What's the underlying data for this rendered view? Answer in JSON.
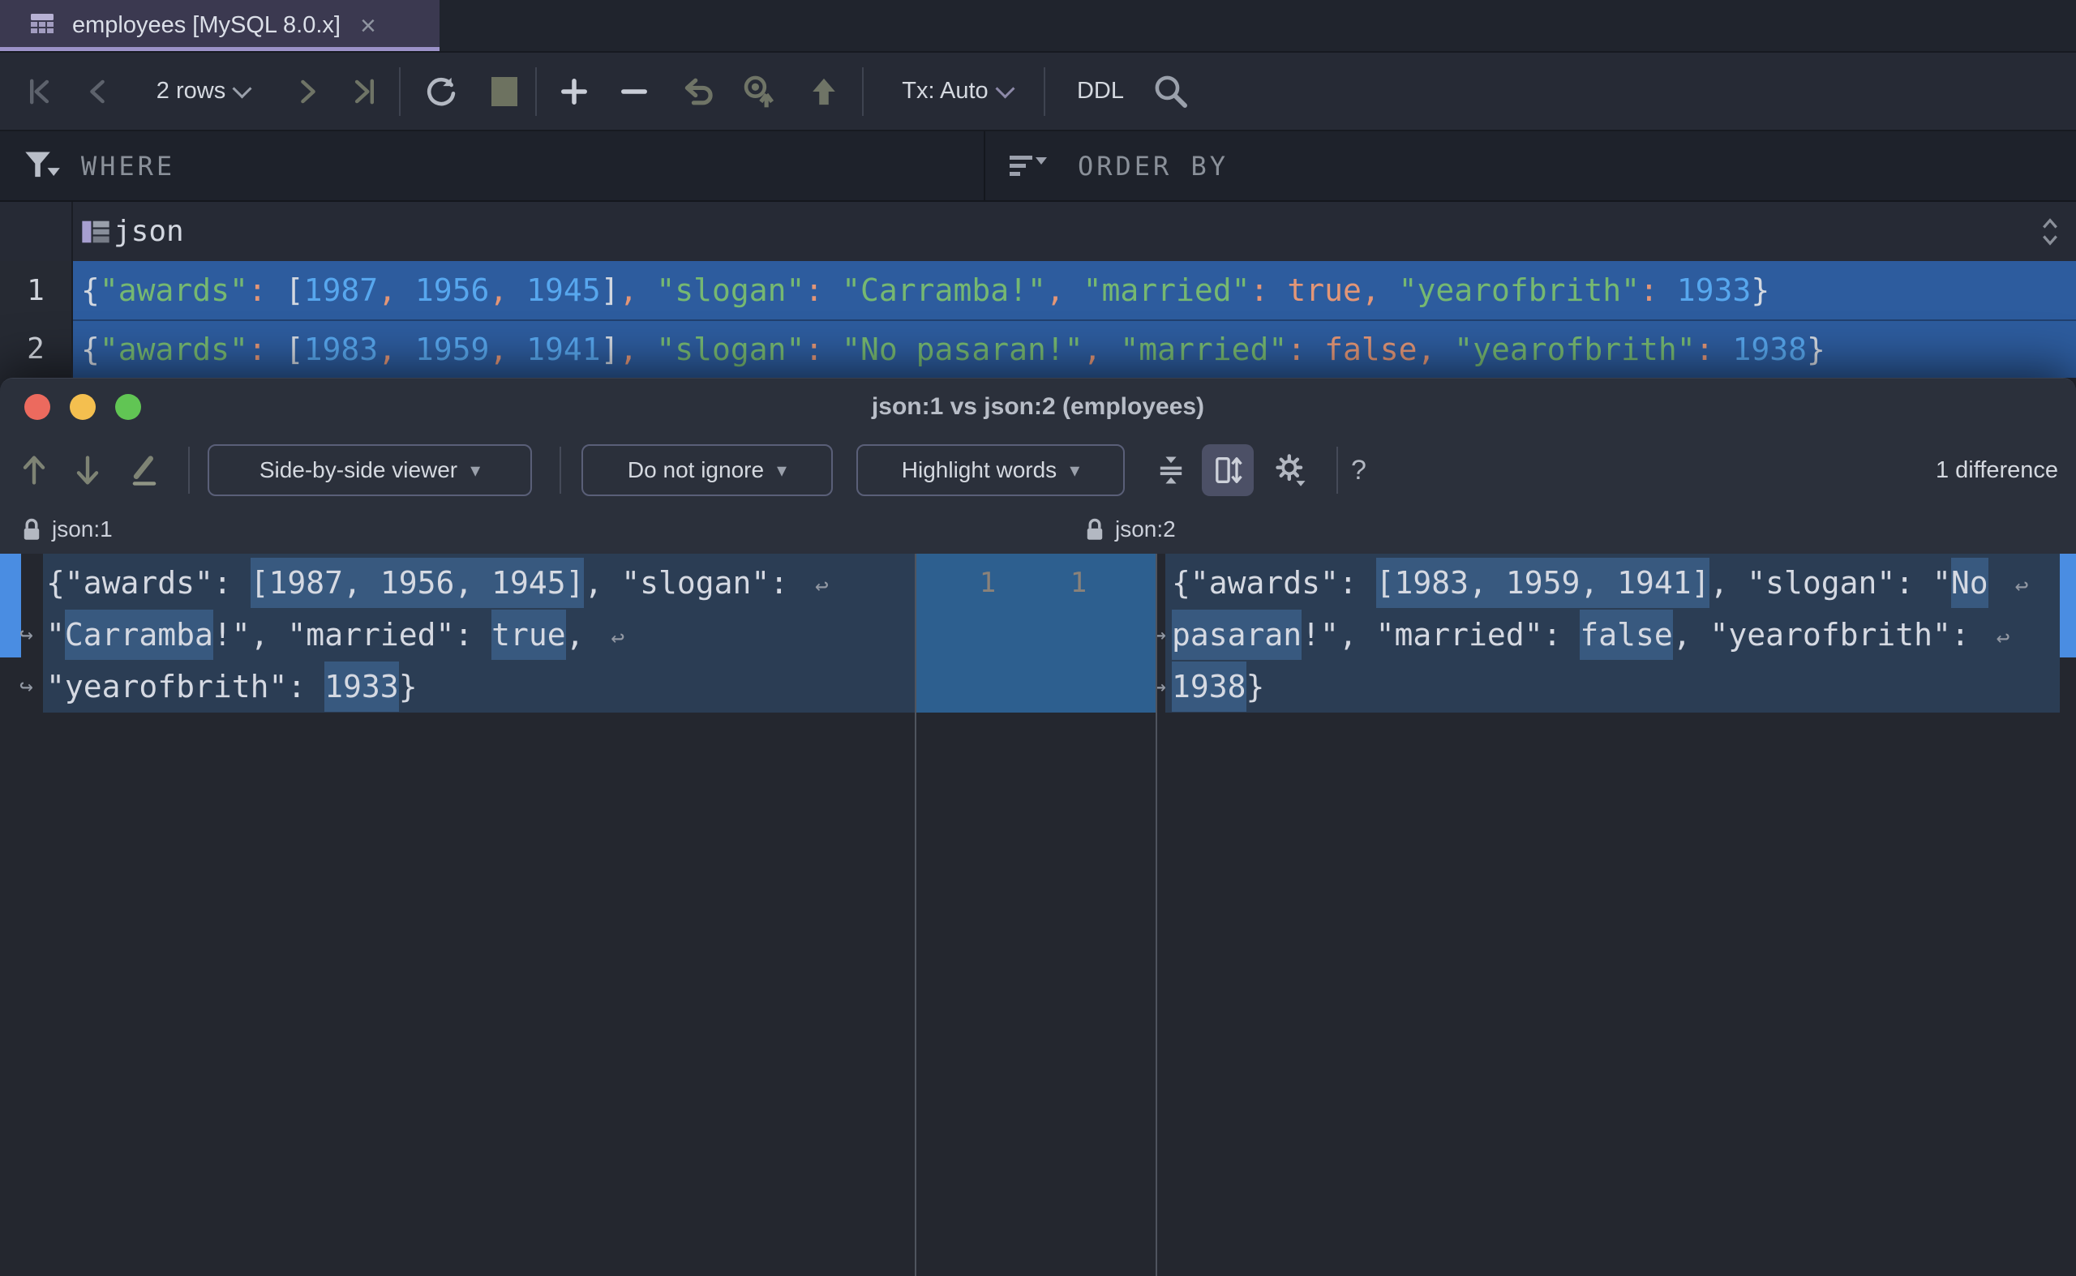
{
  "tab": {
    "title": "employees [MySQL 8.0.x]",
    "close_glyph": "×"
  },
  "toolbar": {
    "rows_count": "2 rows",
    "tx_mode": "Tx: Auto",
    "ddl_label": "DDL"
  },
  "filters": {
    "where": "WHERE",
    "order_by": "ORDER BY"
  },
  "grid": {
    "column_name": "json",
    "rows": [
      {
        "num": "1",
        "segments": [
          [
            "p",
            "{"
          ],
          [
            "k",
            "\"awards\""
          ],
          [
            "s",
            ":"
          ],
          [
            "p",
            " ["
          ],
          [
            "n",
            "1987"
          ],
          [
            "s",
            ","
          ],
          [
            "p",
            " "
          ],
          [
            "n",
            "1956"
          ],
          [
            "s",
            ","
          ],
          [
            "p",
            " "
          ],
          [
            "n",
            "1945"
          ],
          [
            "p",
            "]"
          ],
          [
            "s",
            ","
          ],
          [
            "p",
            " "
          ],
          [
            "k",
            "\"slogan\""
          ],
          [
            "s",
            ":"
          ],
          [
            "p",
            " "
          ],
          [
            "k",
            "\"Carramba!\""
          ],
          [
            "s",
            ","
          ],
          [
            "p",
            " "
          ],
          [
            "k",
            "\"married\""
          ],
          [
            "s",
            ":"
          ],
          [
            "p",
            " "
          ],
          [
            "s",
            "true,"
          ],
          [
            "p",
            " "
          ],
          [
            "k",
            "\"yearofbrith\""
          ],
          [
            "s",
            ":"
          ],
          [
            "p",
            " "
          ],
          [
            "n",
            "1933"
          ],
          [
            "p",
            "}"
          ]
        ]
      },
      {
        "num": "2",
        "segments": [
          [
            "p",
            "{"
          ],
          [
            "k",
            "\"awards\""
          ],
          [
            "s",
            ":"
          ],
          [
            "p",
            " ["
          ],
          [
            "n",
            "1983"
          ],
          [
            "s",
            ","
          ],
          [
            "p",
            " "
          ],
          [
            "n",
            "1959"
          ],
          [
            "s",
            ","
          ],
          [
            "p",
            " "
          ],
          [
            "n",
            "1941"
          ],
          [
            "p",
            "]"
          ],
          [
            "s",
            ","
          ],
          [
            "p",
            " "
          ],
          [
            "k",
            "\"slogan\""
          ],
          [
            "s",
            ":"
          ],
          [
            "p",
            " "
          ],
          [
            "k",
            "\"No pasaran!\""
          ],
          [
            "s",
            ","
          ],
          [
            "p",
            " "
          ],
          [
            "k",
            "\"married\""
          ],
          [
            "s",
            ":"
          ],
          [
            "p",
            " "
          ],
          [
            "s",
            "false,"
          ],
          [
            "p",
            " "
          ],
          [
            "k",
            "\"yearofbrith\""
          ],
          [
            "s",
            ":"
          ],
          [
            "p",
            " "
          ],
          [
            "n",
            "1938"
          ],
          [
            "p",
            "}"
          ]
        ]
      }
    ]
  },
  "diff": {
    "title": "json:1 vs json:2 (employees)",
    "toolbar": {
      "viewer_mode": "Side-by-side viewer",
      "ignore_policy": "Do not ignore",
      "highlight_mode": "Highlight words",
      "dropdown_glyph": "▾",
      "help_label": "?",
      "status": "1 difference"
    },
    "wrap_start_glyph": "↪",
    "wrap_end_glyph": "↩",
    "left": {
      "name": "json:1",
      "lines": [
        {
          "pre": false,
          "post": true,
          "segs": [
            [
              "",
              "{\"awards\": "
            ],
            [
              "h",
              "[1987, 1956, 1945]"
            ],
            [
              "",
              ", \"slogan\": "
            ]
          ]
        },
        {
          "pre": true,
          "post": true,
          "segs": [
            [
              "",
              "\""
            ],
            [
              "h",
              "Carramba"
            ],
            [
              "",
              "!\", \"married\": "
            ],
            [
              "h",
              "true"
            ],
            [
              "",
              ", "
            ]
          ]
        },
        {
          "pre": true,
          "post": false,
          "segs": [
            [
              "",
              "\"yearofbrith\": "
            ],
            [
              "h",
              "1933"
            ],
            [
              "",
              "}"
            ]
          ]
        }
      ]
    },
    "right": {
      "name": "json:2",
      "lines": [
        {
          "pre": false,
          "post": true,
          "segs": [
            [
              "",
              "{\"awards\": "
            ],
            [
              "h",
              "[1983, 1959, 1941]"
            ],
            [
              "",
              ", \"slogan\": \""
            ],
            [
              "h",
              "No"
            ],
            [
              "",
              " "
            ]
          ]
        },
        {
          "pre": true,
          "post": true,
          "segs": [
            [
              "h",
              "pasaran"
            ],
            [
              "",
              "!\", \"married\": "
            ],
            [
              "h",
              "false"
            ],
            [
              "",
              ", \"yearofbrith\": "
            ]
          ]
        },
        {
          "pre": true,
          "post": false,
          "segs": [
            [
              "h",
              "1938"
            ],
            [
              "",
              "}"
            ]
          ]
        }
      ]
    },
    "gutter_numbers": [
      "1",
      "1"
    ]
  },
  "colors": {
    "selection_blue": "#2d5c9e",
    "diff_changed_bg": "#2b3d54",
    "diff_word_highlight": "#38597f",
    "diff_gutter_bg": "#2d5f8f",
    "diff_stripe": "#4a8de2",
    "syntax_green": "#76b871",
    "syntax_blue": "#57a7ee",
    "syntax_orange": "#e39677",
    "tab_accent": "#9c92c8",
    "traffic_red": "#ec6a5e",
    "traffic_yellow": "#f4bf4f",
    "traffic_green": "#61c554"
  }
}
